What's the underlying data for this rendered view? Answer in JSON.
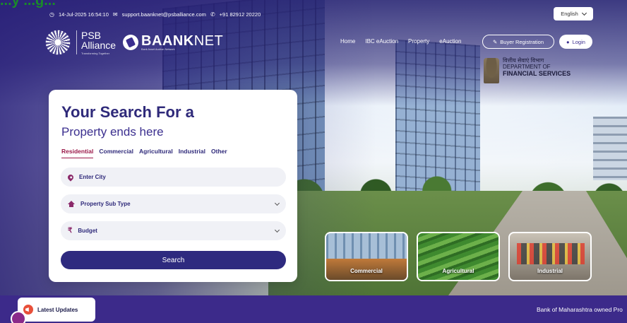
{
  "corner_text": "...y ...g...",
  "topbar": {
    "datetime": "14-Jul-2025 16:54:10",
    "email": "support.baanknet@psballiance.com",
    "phone": "+91 82912 20220",
    "language": "English"
  },
  "logo": {
    "psb_line1": "PSB",
    "psb_line2": "Alliance",
    "psb_tagline": "Transforming Together",
    "baank_bold": "BAANK",
    "baank_light": "NET",
    "baank_sub": "Bank Asset Auction Network"
  },
  "nav": {
    "items": [
      "Home",
      "IBC eAuction",
      "Property",
      "eAuction"
    ],
    "buyer_registration": "Buyer Registration",
    "login": "Login"
  },
  "dfs": {
    "hindi": "वित्तीय सेवाएं विभाग",
    "line1": "DEPARTMENT OF",
    "line2": "FINANCIAL SERVICES"
  },
  "search": {
    "title": "Your Search For a",
    "subtitle": "Property ends here",
    "tabs": [
      "Residential",
      "Commercial",
      "Agricultural",
      "Industrial",
      "Other"
    ],
    "active_tab": "Residential",
    "city_placeholder": "Enter City",
    "subtype_placeholder": "Property Sub Type",
    "budget_placeholder": "Budget",
    "button": "Search"
  },
  "categories": [
    "Commercial",
    "Agricultural",
    "Industrial"
  ],
  "bottom": {
    "updates_label": "Latest Updates",
    "ticker": "Bank of Maharashtra owned Pro"
  },
  "colors": {
    "primary": "#2e2a7f",
    "accent": "#9b1a4a",
    "strip": "#3c2a8a"
  }
}
